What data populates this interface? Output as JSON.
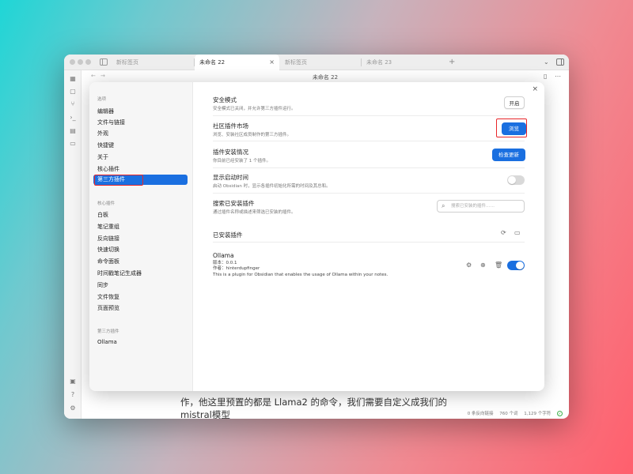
{
  "tabs": [
    {
      "label": "新标签页"
    },
    {
      "label": "未命名 22",
      "active": true
    },
    {
      "label": "新标签页"
    },
    {
      "label": "未命名 23"
    }
  ],
  "tab_close_glyph": "×",
  "tab_new_glyph": "+",
  "note_title": "未命名 22",
  "editor_text": "作，他这里预置的都是 Llama2 的命令，我们需要自定义成我们的 mistral模型",
  "status_bar": {
    "backlinks": "0 条反向链接",
    "words": "760 个词",
    "chars": "1,129 个字符"
  },
  "modal": {
    "close_glyph": "×",
    "sidebar": {
      "options_heading": "选项",
      "options": [
        "编辑器",
        "文件与链接",
        "外观",
        "快捷键",
        "关于",
        "核心插件",
        "第三方插件"
      ],
      "active_option": "第三方插件",
      "core_heading": "核心插件",
      "core_plugins": [
        "白板",
        "笔记重组",
        "反向链接",
        "快速切换",
        "命令面板",
        "时间戳笔记生成器",
        "同步",
        "文件恢复",
        "页面预览"
      ],
      "third_heading": "第三方插件",
      "third_plugins": [
        "Ollama"
      ]
    },
    "settings": [
      {
        "title": "安全模式",
        "desc": "安全模式已关闭，并允许第三方插件运行。",
        "control": "button",
        "button_label": "开启"
      },
      {
        "title": "社区插件市场",
        "desc": "浏览、安装社区成员制作的第三方插件。",
        "control": "primary-button",
        "button_label": "浏览"
      },
      {
        "title": "插件安装情况",
        "desc": "你目前已经安装了 1 个插件。",
        "control": "primary-button",
        "button_label": "检查更新"
      },
      {
        "title": "显示启动时间",
        "desc": "启动 Obsidian 时，显示各插件初始化所需的时间及其总和。",
        "control": "toggle",
        "toggle_on": false
      },
      {
        "title": "搜索已安装插件",
        "desc": "通过插件名称或描述来筛选已安装的插件。",
        "control": "search",
        "placeholder": "搜索已安装的插件……"
      }
    ],
    "installed_heading": "已安装插件",
    "plugin": {
      "name": "Ollama",
      "version": "版本：0.0.1",
      "author": "作者：hinterdupfinger",
      "description": "This is a plugin for Obsidian that enables the usage of Ollama within your notes.",
      "enabled": true
    }
  },
  "colors": {
    "accent": "#1a6fe0",
    "highlight": "#e8262a"
  }
}
